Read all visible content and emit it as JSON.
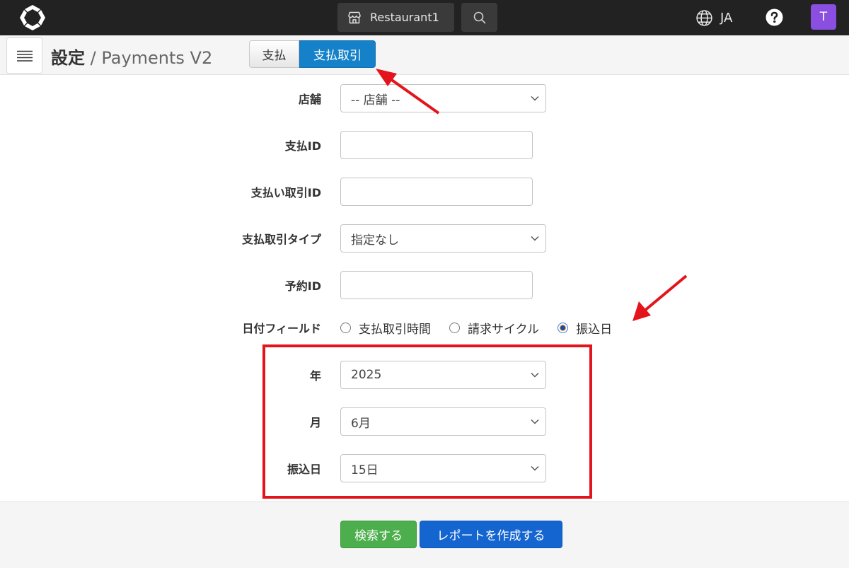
{
  "topbar": {
    "store_name": "Restaurant1",
    "language": "JA",
    "avatar_initial": "T"
  },
  "header": {
    "title_main": "設定",
    "title_separator": " / ",
    "title_sub": "Payments V2",
    "tabs": [
      {
        "label": "支払",
        "active": false
      },
      {
        "label": "支払取引",
        "active": true
      }
    ]
  },
  "form": {
    "store": {
      "label": "店舗",
      "value": "-- 店舗 --"
    },
    "payment_id": {
      "label": "支払ID",
      "value": ""
    },
    "payment_transaction_id": {
      "label": "支払い取引ID",
      "value": ""
    },
    "transaction_type": {
      "label": "支払取引タイプ",
      "value": "指定なし"
    },
    "reservation_id": {
      "label": "予約ID",
      "value": ""
    },
    "date_field": {
      "label": "日付フィールド",
      "options": [
        {
          "label": "支払取引時間",
          "checked": false
        },
        {
          "label": "請求サイクル",
          "checked": false
        },
        {
          "label": "振込日",
          "checked": true
        }
      ]
    },
    "year": {
      "label": "年",
      "value": "2025"
    },
    "month": {
      "label": "月",
      "value": "6月"
    },
    "transfer_day": {
      "label": "振込日",
      "value": "15日"
    }
  },
  "footer": {
    "search_label": "検索する",
    "report_label": "レポートを作成する"
  },
  "colors": {
    "topbar": "#222222",
    "active_tab": "#1581c8",
    "search_button": "#4cae4c",
    "report_button": "#1565d0",
    "annotation": "#e3141b",
    "avatar": "#8a4fe0"
  }
}
